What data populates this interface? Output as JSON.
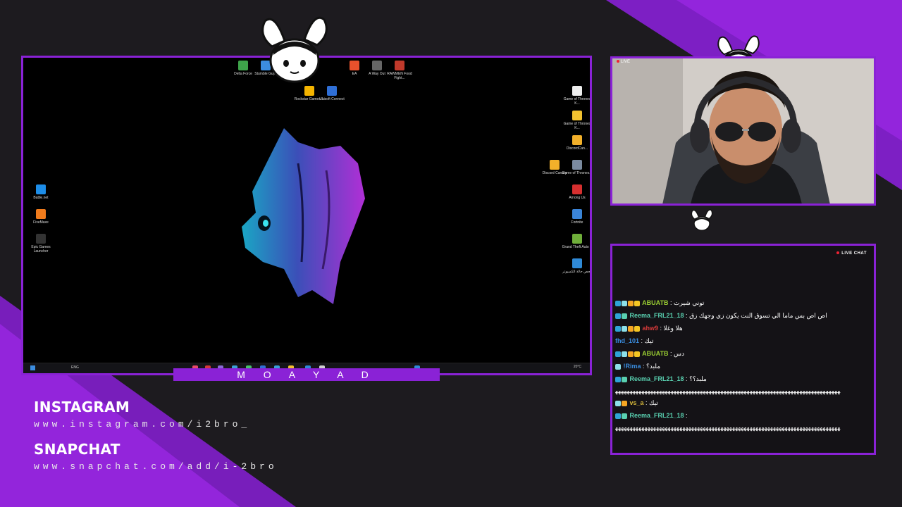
{
  "overlay": {
    "streamer_name": "M O A Y A D",
    "colors": {
      "accent": "#8a22d6",
      "accent_light": "#a52af0",
      "background": "#1d1b1f"
    }
  },
  "desktop": {
    "top_icons": [
      {
        "label": "Delta Force",
        "icon": "delta-force-icon",
        "color": "#3ea34a"
      },
      {
        "label": "Stumble Guys",
        "icon": "stumble-guys-icon",
        "color": "#3c8de0"
      },
      {
        "label": "EA",
        "icon": "ea-icon",
        "color": "#e8512c"
      },
      {
        "label": "A Way Out",
        "icon": "a-way-out-icon",
        "color": "#666666"
      },
      {
        "label": "RAWMEN Food Fight...",
        "icon": "rawmen-icon",
        "color": "#c0392b"
      }
    ],
    "mid_icons": [
      {
        "label": "Rockstar Games ...",
        "icon": "rockstar-icon",
        "color": "#f4b400"
      },
      {
        "label": "Ubisoft Connect",
        "icon": "ubisoft-icon",
        "color": "#2f6fd6"
      }
    ],
    "left_icons": [
      {
        "label": "Battle.net",
        "icon": "battlenet-icon",
        "color": "#1d8de8"
      },
      {
        "label": "FiveMaxe",
        "icon": "fivem-icon",
        "color": "#f07b1c"
      },
      {
        "label": "Epic Games Launcher",
        "icon": "epic-games-icon",
        "color": "#333333"
      }
    ],
    "right_icons": [
      {
        "label": "Game of Thrones K...",
        "icon": "file-icon",
        "color": "#eeeeee"
      },
      {
        "label": "Game of Thrones K...",
        "icon": "folder-icon",
        "color": "#f2c230"
      },
      {
        "label": "DiscordCan...",
        "icon": "discord-canary-icon",
        "color": "#f2b02a"
      },
      {
        "label": "Game of Thrones...",
        "icon": "game-icon",
        "color": "#7a8aa0"
      },
      {
        "label": "Among Us",
        "icon": "among-us-icon",
        "color": "#d62f2f"
      },
      {
        "label": "Fortnite",
        "icon": "fortnite-icon",
        "color": "#3a84d8"
      },
      {
        "label": "Grand Theft Auto V",
        "icon": "gta-icon",
        "color": "#6fae3a"
      },
      {
        "label": "فحص حالة الكمبيوتر",
        "icon": "pc-health-icon",
        "color": "#2f8ad8"
      }
    ],
    "extra_icon": {
      "label": "Discord Canary",
      "icon": "discord-icon",
      "color": "#f2b02a"
    },
    "taskbar": {
      "language": "ENG",
      "time": "20°C"
    }
  },
  "webcam": {
    "live_label": "LIVE"
  },
  "chat": {
    "header": "LIVE CHAT",
    "messages": [
      {
        "user": "ABUATB",
        "user_color": "#9acd32",
        "text": ": توني شيرت",
        "badges": [
          "#2fa4d6",
          "#8de0e8",
          "#f5a623",
          "#f5c623"
        ]
      },
      {
        "user": "Reema_FRL21_18",
        "user_color": "#59d0b0",
        "text": ": اص اص بس ماما الي تسوق النت يكون زي وجهك زق",
        "badges": [
          "#2fa4d6",
          "#59d0b0"
        ]
      },
      {
        "user": "ahw9",
        "user_color": "#d93a3a",
        "text": ": هلا وغلا",
        "badges": [
          "#2fa4d6",
          "#8de0e8",
          "#f5a623",
          "#f5c623"
        ]
      },
      {
        "user": "fhd_101",
        "user_color": "#3a8de0",
        "text": ": تيك",
        "badges": []
      },
      {
        "user": "ABUATB",
        "user_color": "#9acd32",
        "text": ": دس",
        "badges": [
          "#2fa4d6",
          "#8de0e8",
          "#f5a623",
          "#f5c623"
        ]
      },
      {
        "user": "!Rima",
        "user_color": "#3a8de0",
        "text": ": ملبد؟",
        "badges": [
          "#8de0e8"
        ]
      },
      {
        "user": "Reema_FRL21_18",
        "user_color": "#59d0b0",
        "text": ": ملبد؟؟",
        "badges": [
          "#2fa4d6",
          "#59d0b0"
        ]
      },
      {
        "user": "",
        "user_color": "#ffffff",
        "text": "ﻬﻬﻬﻬﻬﻬﻬﻬﻬﻬﻬﻬﻬﻬﻬﻬﻬﻬﻬﻬﻬﻬﻬﻬﻬﻬﻬﻬﻬﻬﻬﻬﻬﻬﻬﻬﻬﻬﻬﻬﻬﻬﻬﻬﻬﻬﻬﻬﻬﻬﻬﻬﻬﻬﻬﻬﻬﻬﻬﻬﻬﻬﻬﻬﻬﻬﻬﻬﻬﻬﻬﻬﻬﻬﻬﻬﻬ",
        "badges": []
      },
      {
        "user": "vs_a",
        "user_color": "#d4b63a",
        "text": ": تيك",
        "badges": [
          "#8de0e8",
          "#f5a623"
        ]
      },
      {
        "user": "Reema_FRL21_18",
        "user_color": "#59d0b0",
        "text": ":",
        "badges": [
          "#2fa4d6",
          "#59d0b0"
        ]
      },
      {
        "user": "",
        "user_color": "#ffffff",
        "text": "ﻬﻬﻬﻬﻬﻬﻬﻬﻬﻬﻬﻬﻬﻬﻬﻬﻬﻬﻬﻬﻬﻬﻬﻬﻬﻬﻬﻬﻬﻬﻬﻬﻬﻬﻬﻬﻬﻬﻬﻬﻬﻬﻬﻬﻬﻬﻬﻬﻬﻬﻬﻬﻬﻬﻬﻬﻬﻬﻬﻬﻬﻬﻬﻬﻬﻬﻬﻬﻬﻬﻬﻬﻬﻬﻬﻬﻬ",
        "badges": []
      }
    ]
  },
  "socials": {
    "instagram_title": "INSTAGRAM",
    "instagram_url": "www.instagram.com/i2bro_",
    "snapchat_title": "SNAPCHAT",
    "snapchat_url": "www.snapchat.com/add/i-2bro"
  }
}
